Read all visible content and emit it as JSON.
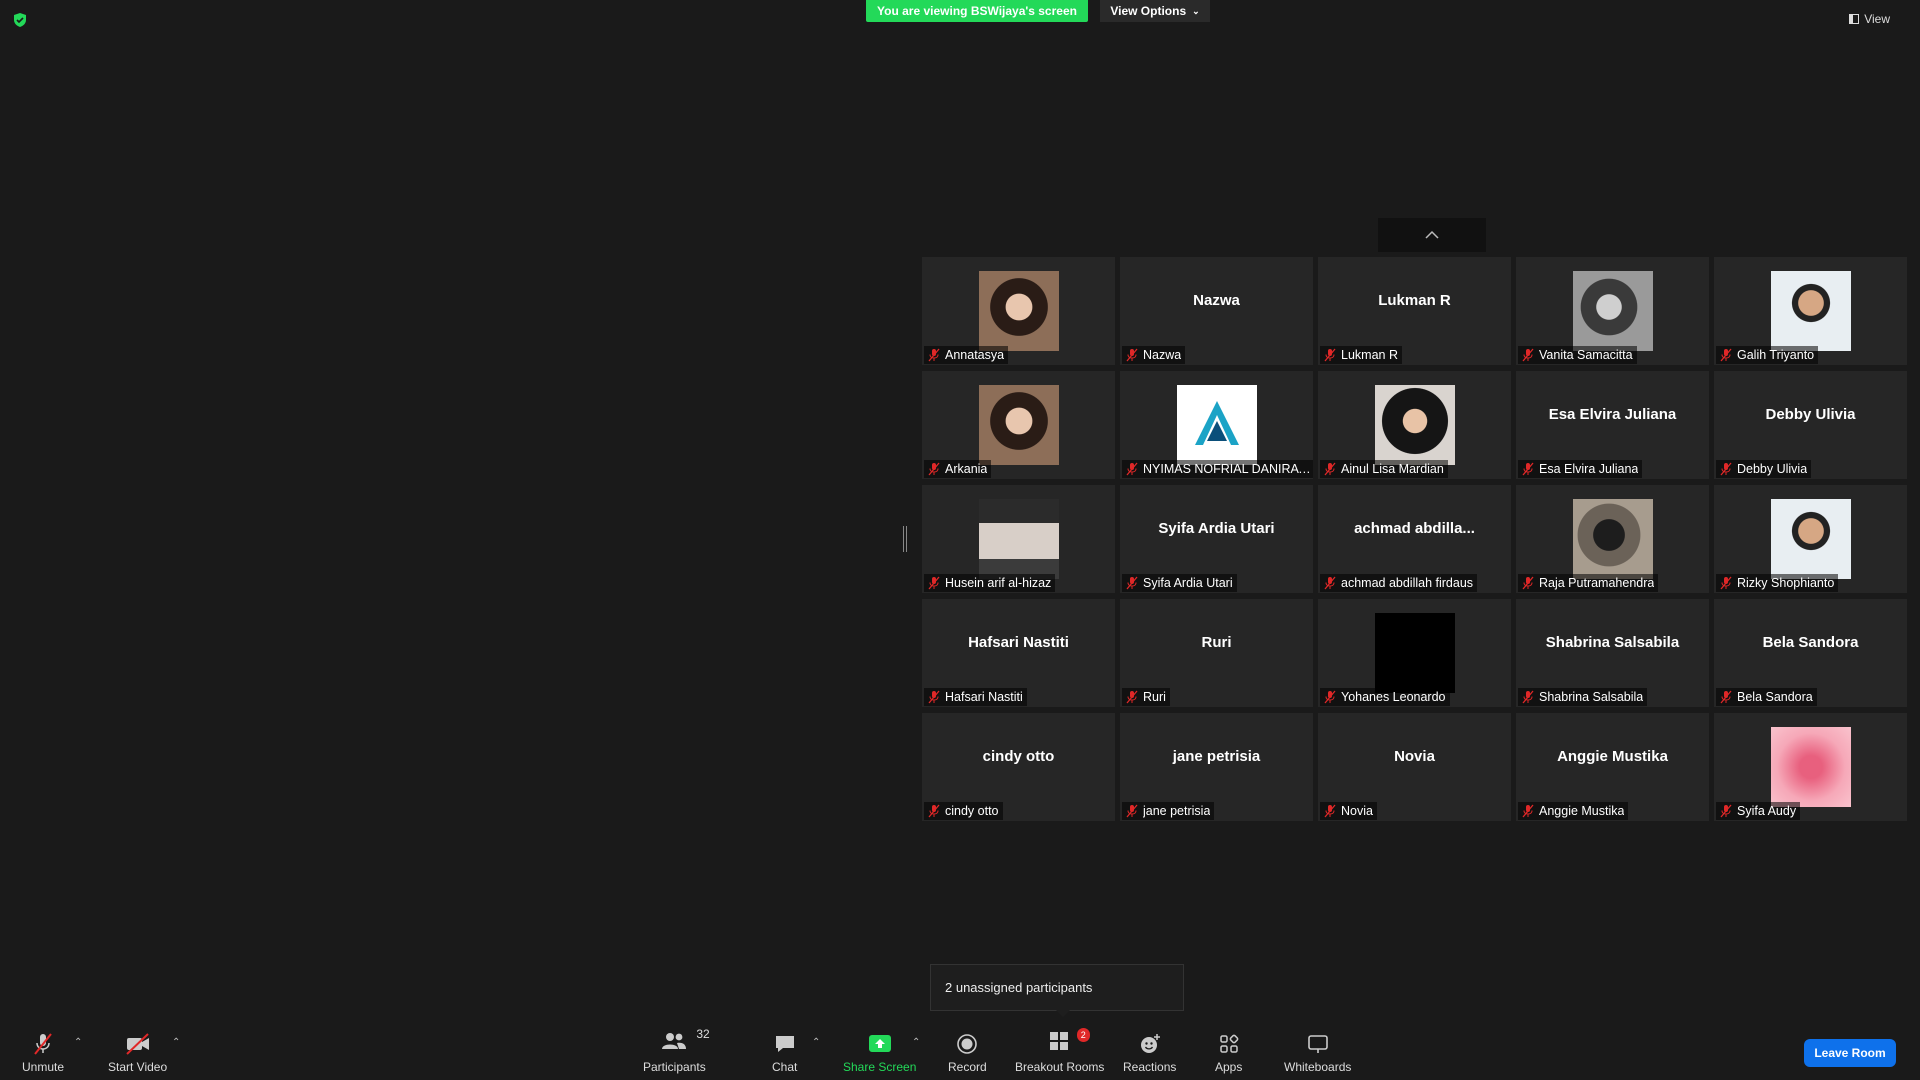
{
  "banner": {
    "text": "You are viewing BSWijaya's screen",
    "view_options": "View Options"
  },
  "top_right": {
    "view": "View"
  },
  "tooltip": {
    "text": "2 unassigned participants"
  },
  "participants": [
    {
      "display": "Annatasya",
      "name": "Annatasya",
      "avatar": "photo"
    },
    {
      "display": "Nazwa",
      "name": "Nazwa",
      "avatar": ""
    },
    {
      "display": "Lukman R",
      "name": "Lukman R",
      "avatar": ""
    },
    {
      "display": "Vanita Samacitta",
      "name": "Vanita Samacitta",
      "avatar": "photo-bw"
    },
    {
      "display": "Galih Triyanto",
      "name": "Galih Triyanto",
      "avatar": "photo-light"
    },
    {
      "display": "Arkania",
      "name": "Arkania",
      "avatar": "photo"
    },
    {
      "display": "NYIMAS NOFRIAL DANIRA ...",
      "name": "NYIMAS NOFRIAL DANIRA ...",
      "avatar": "logo"
    },
    {
      "display": "Ainul Lisa Mardian",
      "name": "Ainul Lisa Mardian",
      "avatar": "photo-hijab"
    },
    {
      "display": "Esa Elvira Juliana",
      "name": "Esa Elvira Juliana",
      "avatar": ""
    },
    {
      "display": "Debby Ulivia",
      "name": "Debby Ulivia",
      "avatar": ""
    },
    {
      "display": "Husein arif al-hizaz",
      "name": "Husein arif al-hizaz",
      "avatar": "anime"
    },
    {
      "display": "Syifa Ardia Utari",
      "name": "Syifa Ardia Utari",
      "avatar": ""
    },
    {
      "display": "achmad  abdilla...",
      "name": "achmad abdillah firdaus",
      "avatar": ""
    },
    {
      "display": "Raja Putramahendra",
      "name": "Raja Putramahendra",
      "avatar": "photo-dark"
    },
    {
      "display": "Rizky Shophianto",
      "name": "Rizky Shophianto",
      "avatar": "photo-light"
    },
    {
      "display": "Hafsari Nastiti",
      "name": "Hafsari Nastiti",
      "avatar": ""
    },
    {
      "display": "Ruri",
      "name": "Ruri",
      "avatar": ""
    },
    {
      "display": "Yohanes Leonardo",
      "name": "Yohanes Leonardo",
      "avatar": "black"
    },
    {
      "display": "Shabrina Salsabila",
      "name": "Shabrina Salsabila",
      "avatar": ""
    },
    {
      "display": "Bela Sandora",
      "name": "Bela Sandora",
      "avatar": ""
    },
    {
      "display": "cindy otto",
      "name": "cindy otto",
      "avatar": ""
    },
    {
      "display": "jane petrisia",
      "name": "jane petrisia",
      "avatar": ""
    },
    {
      "display": "Novia",
      "name": "Novia",
      "avatar": ""
    },
    {
      "display": "Anggie Mustika",
      "name": "Anggie Mustika",
      "avatar": ""
    },
    {
      "display": "Syifa Audy",
      "name": "Syifa Audy",
      "avatar": "pink"
    }
  ],
  "toolbar": {
    "unmute": "Unmute",
    "start_video": "Start Video",
    "participants": "Participants",
    "participants_count": "32",
    "chat": "Chat",
    "share_screen": "Share Screen",
    "record": "Record",
    "breakout_rooms": "Breakout Rooms",
    "breakout_badge": "2",
    "reactions": "Reactions",
    "apps": "Apps",
    "whiteboards": "Whiteboards",
    "leave_room": "Leave Room"
  },
  "colors": {
    "accent_green": "#23d959",
    "leave_blue": "#0e71eb",
    "muted_red": "#e02828"
  }
}
